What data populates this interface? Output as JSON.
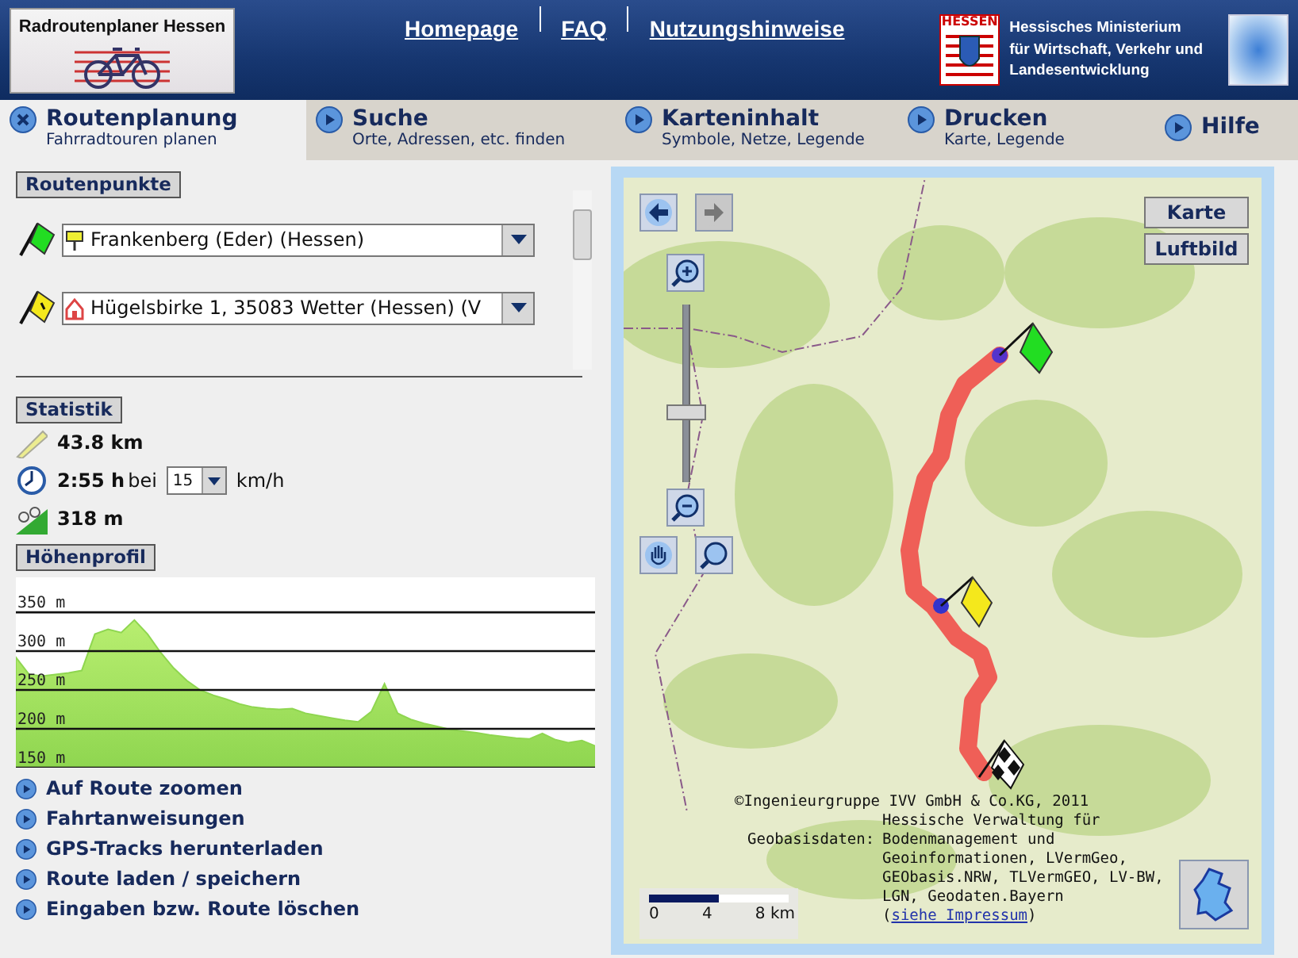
{
  "header": {
    "logo_title": "Radroutenplaner Hessen",
    "nav_links": [
      "Homepage",
      "FAQ",
      "Nutzungshinweise"
    ],
    "state_badge": "HESSEN",
    "ministry_lines": [
      "Hessisches Ministerium",
      "für Wirtschaft, Verkehr und",
      "Landesentwicklung"
    ]
  },
  "tabs": [
    {
      "title": "Routenplanung",
      "subtitle": "Fahrradtouren planen",
      "selected": true
    },
    {
      "title": "Suche",
      "subtitle": "Orte, Adressen, etc. finden",
      "selected": false
    },
    {
      "title": "Karteninhalt",
      "subtitle": "Symbole, Netze, Legende",
      "selected": false
    },
    {
      "title": "Drucken",
      "subtitle": "Karte, Legende",
      "selected": false
    },
    {
      "title": "Hilfe",
      "selected": false
    }
  ],
  "route_points": {
    "heading": "Routenpunkte",
    "items": [
      {
        "kind": "start",
        "place": {
          "kind": "town",
          "value": "Frankenberg (Eder) (Hessen)"
        }
      },
      {
        "kind": "via",
        "place": {
          "kind": "address",
          "value": "Hügelsbirke 1, 35083 Wetter (Hessen) (V"
        }
      }
    ]
  },
  "statistics": {
    "heading": "Statistik",
    "distance": "43.8 km",
    "duration": "2:55 h",
    "speed_prefix": "bei",
    "speed": "15",
    "speed_unit": "km/h",
    "climb": "318 m"
  },
  "elevation_profile": {
    "heading": "Höhenprofil",
    "chart_data": {
      "type": "area",
      "grid": true,
      "ylim": [
        150,
        395
      ],
      "yticks": [
        {
          "value": 150,
          "label": "150 m"
        },
        {
          "value": 200,
          "label": "200 m"
        },
        {
          "value": 250,
          "label": "250 m"
        },
        {
          "value": 300,
          "label": "300 m"
        },
        {
          "value": 350,
          "label": "350 m"
        }
      ],
      "series": [
        {
          "color": "#8fd650",
          "values": [
            292,
            270,
            268,
            270,
            272,
            275,
            322,
            328,
            324,
            340,
            322,
            298,
            278,
            262,
            250,
            243,
            238,
            232,
            228,
            226,
            225,
            226,
            220,
            217,
            214,
            211,
            209,
            222,
            258,
            220,
            212,
            207,
            203,
            199,
            197,
            195,
            192,
            190,
            188,
            187,
            194,
            186,
            182,
            185,
            178
          ]
        }
      ]
    }
  },
  "actions": [
    "Auf Route zoomen",
    "Fahrtanweisungen",
    "GPS-Tracks herunterladen",
    "Route laden / speichern",
    "Eingaben bzw. Route löschen"
  ],
  "map": {
    "layer_buttons": [
      "Karte",
      "Luftbild"
    ],
    "forward_disabled": true,
    "zoom": {
      "level": 0.38
    },
    "copyright": "©Ingenieurgruppe IVV GmbH & Co.KG, 2011",
    "source_label": "Geobasisdaten:",
    "source_text": "Hessische Verwaltung für Bodenmanagement und Geoinformationen, LVermGeo, GEObasis.NRW, TLVermGEO, LV-BW, LGN, Geodaten.Bayern (",
    "source_link": "siehe Impressum",
    "source_end": ")",
    "scale_labels": [
      "0",
      "4",
      "8 km"
    ]
  }
}
